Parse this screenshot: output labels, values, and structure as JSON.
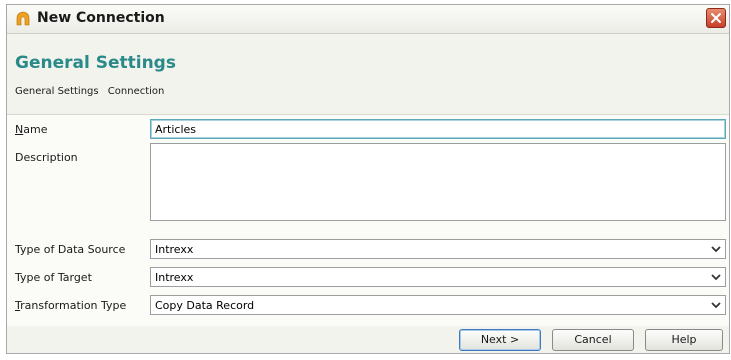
{
  "window": {
    "title": "New Connection",
    "close_label": "Close"
  },
  "header": {
    "section_title": "General Settings",
    "breadcrumb": [
      "General Settings",
      "Connection"
    ]
  },
  "form": {
    "name_label_first": "N",
    "name_label_rest": "ame",
    "name_value": "Articles",
    "description_label": "Description",
    "description_value": "",
    "data_source_label": "Type of Data Source",
    "data_source_value": "Intrexx",
    "target_label": "Type of Target",
    "target_value": "Intrexx",
    "transformation_label_first": "T",
    "transformation_label_rest": "ransformation Type",
    "transformation_value": "Copy Data Record"
  },
  "footer": {
    "next_label": "Next >",
    "cancel_label": "Cancel",
    "help_label": "Help"
  },
  "icons": {
    "app": "intrexx-app-icon",
    "close": "close-icon",
    "dropdown": "chevron-down-icon"
  },
  "colors": {
    "accent": "#2a8a8a",
    "close": "#c7402a"
  }
}
